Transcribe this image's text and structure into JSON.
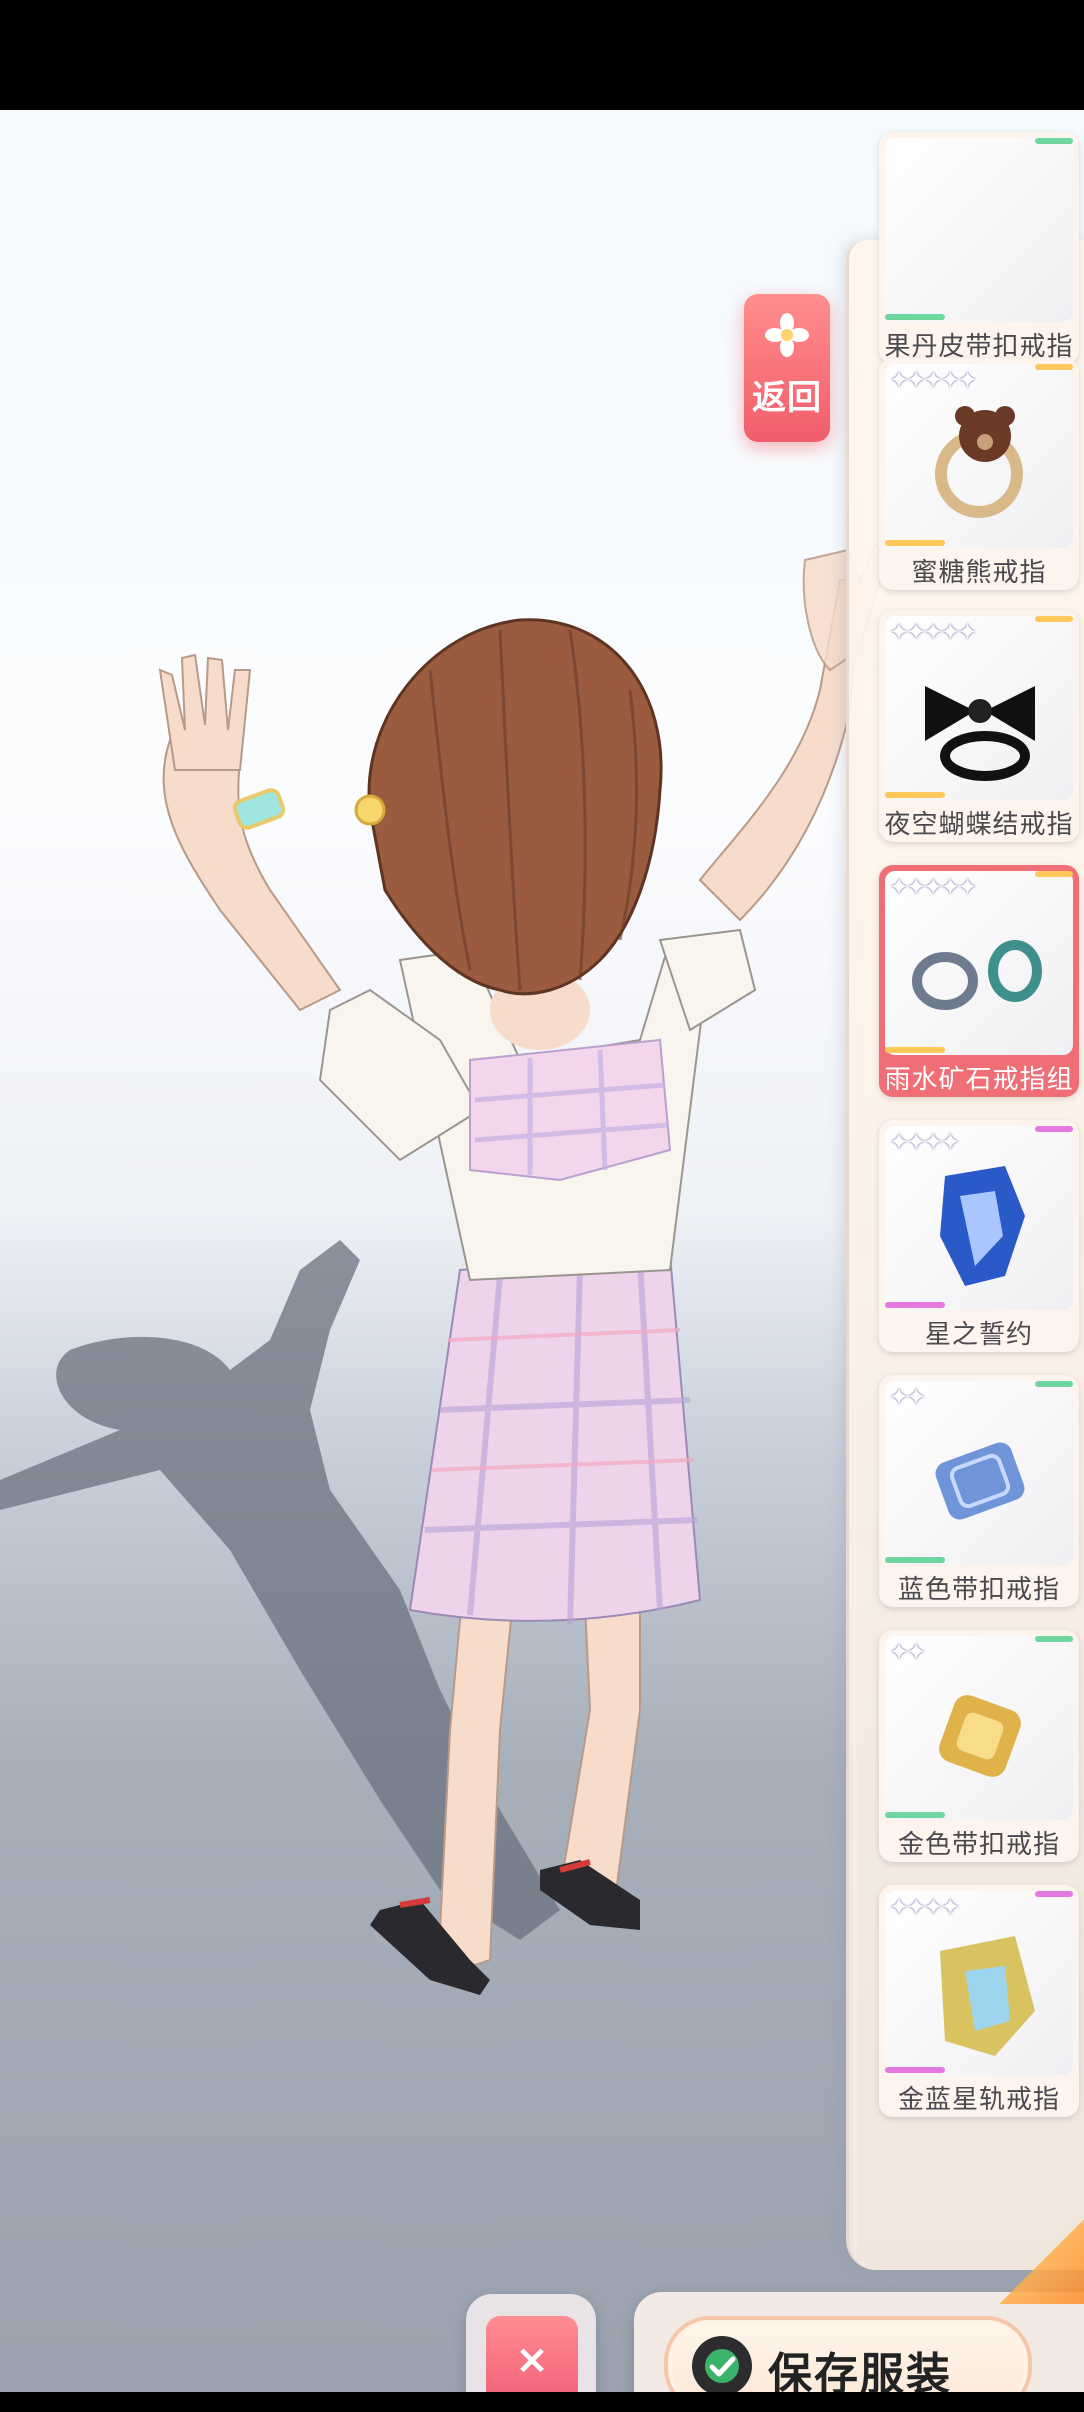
{
  "back_button": {
    "label": "返回"
  },
  "items": [
    {
      "name": "果丹皮带扣戒指",
      "stars": 0,
      "selected": false,
      "rarity_color": "#6fd6a0"
    },
    {
      "name": "蜜糖熊戒指",
      "stars": 5,
      "selected": false,
      "rarity_color": "#ffc85a"
    },
    {
      "name": "夜空蝴蝶结戒指",
      "stars": 5,
      "selected": false,
      "rarity_color": "#ffc85a"
    },
    {
      "name": "雨水矿石戒指组",
      "stars": 5,
      "selected": true,
      "rarity_color": "#ffc85a"
    },
    {
      "name": "星之誓约",
      "stars": 4,
      "selected": false,
      "rarity_color": "#e679e0"
    },
    {
      "name": "蓝色带扣戒指",
      "stars": 2,
      "selected": false,
      "rarity_color": "#6fd6a0"
    },
    {
      "name": "金色带扣戒指",
      "stars": 2,
      "selected": false,
      "rarity_color": "#6fd6a0"
    },
    {
      "name": "金蓝星轨戒指",
      "stars": 4,
      "selected": false,
      "rarity_color": "#e679e0"
    }
  ],
  "actions": {
    "cancel_icon": "×",
    "save_label": "保存服装"
  },
  "colors": {
    "accent": "#f25d6b",
    "panel": "#fbf0e6"
  }
}
